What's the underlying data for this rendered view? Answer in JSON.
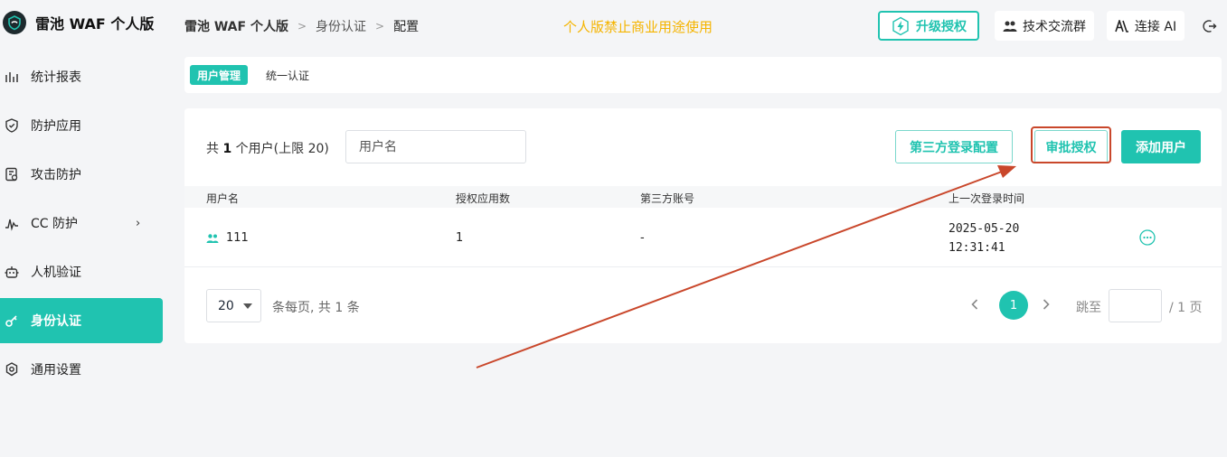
{
  "app": {
    "logo_text": "雷池 WAF 个人版"
  },
  "sidebar": {
    "items": [
      {
        "label": "统计报表",
        "icon": "bar-chart-icon"
      },
      {
        "label": "防护应用",
        "icon": "shield-icon"
      },
      {
        "label": "攻击防护",
        "icon": "attack-log-icon"
      },
      {
        "label": "CC 防护",
        "icon": "pulse-icon",
        "chevron": "›"
      },
      {
        "label": "人机验证",
        "icon": "robot-icon"
      },
      {
        "label": "身份认证",
        "icon": "key-icon",
        "active": true
      },
      {
        "label": "通用设置",
        "icon": "gear-icon"
      }
    ]
  },
  "header": {
    "breadcrumb": [
      "雷池 WAF 个人版",
      "身份认证",
      "配置"
    ],
    "breadcrumb_sep": ">",
    "notice": "个人版禁止商业用途使用",
    "upgrade_label": "升级授权",
    "group_label": "技术交流群",
    "ai_label": "连接 AI"
  },
  "tabs": {
    "items": [
      "用户管理",
      "统一认证"
    ],
    "active": 0
  },
  "users": {
    "count_prefix": "共",
    "count": "1",
    "count_suffix": "个用户(上限 20)",
    "search_placeholder": "用户名",
    "third_party_btn": "第三方登录配置",
    "approve_btn": "审批授权",
    "add_btn": "添加用户",
    "columns": [
      "用户名",
      "授权应用数",
      "第三方账号",
      "上一次登录时间"
    ],
    "rows": [
      {
        "name": "111",
        "apps": "1",
        "third_party": "-",
        "last_login_date": "2025-05-20",
        "last_login_time": "12:31:41"
      }
    ]
  },
  "pagination": {
    "page_size": "20",
    "per_page_text": "条每页, 共 1 条",
    "current_page": "1",
    "jump_label": "跳至",
    "total_pages": "/ 1 页"
  },
  "colors": {
    "accent": "#20c3b0",
    "notice": "#f5b400",
    "annotation": "#c9472b"
  }
}
